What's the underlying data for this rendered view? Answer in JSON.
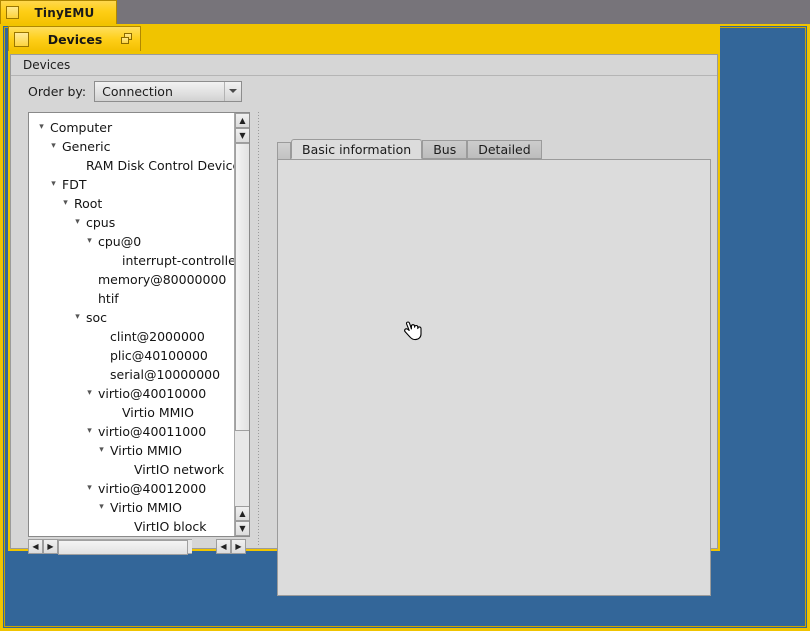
{
  "taskbar": {
    "tiny_tab_label": "TinyEMU",
    "tiny_tab_icon": "window-square-icon"
  },
  "device_window": {
    "title": "Devices",
    "title_icon": "window-square-icon",
    "restore_icon": "restore-window-icon"
  },
  "menubar": {
    "items": [
      {
        "label": "Devices"
      }
    ]
  },
  "toolbar": {
    "order_by_label": "Order by:",
    "order_by_value": "Connection",
    "order_by_arrow_icon": "chevron-down-icon"
  },
  "tree": {
    "rows": [
      {
        "label": "Computer",
        "depth": 0,
        "twisty": "▾"
      },
      {
        "label": "Generic",
        "depth": 1,
        "twisty": "▾"
      },
      {
        "label": "RAM Disk Control Device",
        "depth": 3,
        "twisty": ""
      },
      {
        "label": "FDT",
        "depth": 1,
        "twisty": "▾"
      },
      {
        "label": "Root",
        "depth": 2,
        "twisty": "▾"
      },
      {
        "label": "cpus",
        "depth": 3,
        "twisty": "▾"
      },
      {
        "label": "cpu@0",
        "depth": 4,
        "twisty": "▾"
      },
      {
        "label": "interrupt-controller",
        "depth": 6,
        "twisty": ""
      },
      {
        "label": "memory@80000000",
        "depth": 4,
        "twisty": ""
      },
      {
        "label": "htif",
        "depth": 4,
        "twisty": ""
      },
      {
        "label": "soc",
        "depth": 3,
        "twisty": "▾"
      },
      {
        "label": "clint@2000000",
        "depth": 5,
        "twisty": ""
      },
      {
        "label": "plic@40100000",
        "depth": 5,
        "twisty": ""
      },
      {
        "label": "serial@10000000",
        "depth": 5,
        "twisty": ""
      },
      {
        "label": "virtio@40010000",
        "depth": 4,
        "twisty": "▾"
      },
      {
        "label": "Virtio MMIO",
        "depth": 6,
        "twisty": ""
      },
      {
        "label": "virtio@40011000",
        "depth": 4,
        "twisty": "▾"
      },
      {
        "label": "Virtio MMIO",
        "depth": 5,
        "twisty": "▾"
      },
      {
        "label": "VirtIO network",
        "depth": 7,
        "twisty": ""
      },
      {
        "label": "virtio@40012000",
        "depth": 4,
        "twisty": "▾"
      },
      {
        "label": "Virtio MMIO",
        "depth": 5,
        "twisty": "▾"
      },
      {
        "label": "VirtIO block",
        "depth": 7,
        "twisty": ""
      }
    ],
    "vscrollbar": {
      "up_arrow_icon": "triangle-up-icon",
      "down_arrow_icon": "triangle-down-icon"
    },
    "hscrollbar": {
      "left_arrow_icon": "triangle-left-icon",
      "right_arrow_icon": "triangle-right-icon"
    }
  },
  "tabs": [
    {
      "label": "Basic information",
      "active": true
    },
    {
      "label": "Bus",
      "active": false
    },
    {
      "label": "Detailed",
      "active": false
    }
  ],
  "cursor": {
    "icon": "grab-hand-cursor"
  },
  "colors": {
    "accent_gold": "#f0c400",
    "desktop_blue": "#336699",
    "desktop_gray": "#77747a",
    "panel_gray": "#d6d6d6",
    "tab_active": "#dcdcdc"
  }
}
